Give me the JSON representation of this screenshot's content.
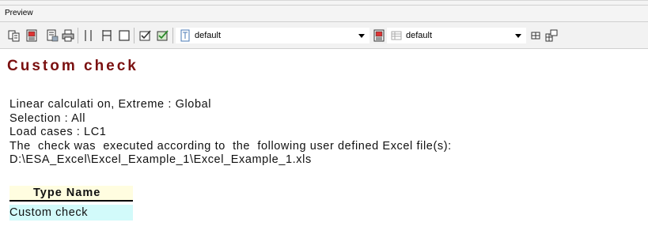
{
  "window": {
    "title": "Preview"
  },
  "toolbar": {
    "combo_style": {
      "value": "default"
    },
    "combo_layout": {
      "value": "default"
    }
  },
  "document": {
    "title": "Custom check",
    "lines": [
      "Linear calculati on, Extreme : Global",
      "Selection : All",
      "Load cases : LC1",
      "The  check was  executed according to  the  following user defined Excel file(s):",
      "D:\\ESA_Excel\\Excel_Example_1\\Excel_Example_1.xls"
    ],
    "table": {
      "header": "Type Name",
      "rows": [
        "Custom check"
      ]
    }
  },
  "colors": {
    "title": "#7a1010",
    "table_header_bg": "#fffde0",
    "table_row_bg": "#d2fafa"
  },
  "icons": [
    "copy-icon",
    "print-preview-icon",
    "export-icon",
    "print-icon",
    "single-column-icon",
    "columns-icon",
    "frame-icon",
    "check-icon",
    "check-green-icon",
    "page-icon",
    "book-icon",
    "table-icon",
    "grid-icon",
    "layout-icon",
    "dropdown-arrow-icon"
  ]
}
